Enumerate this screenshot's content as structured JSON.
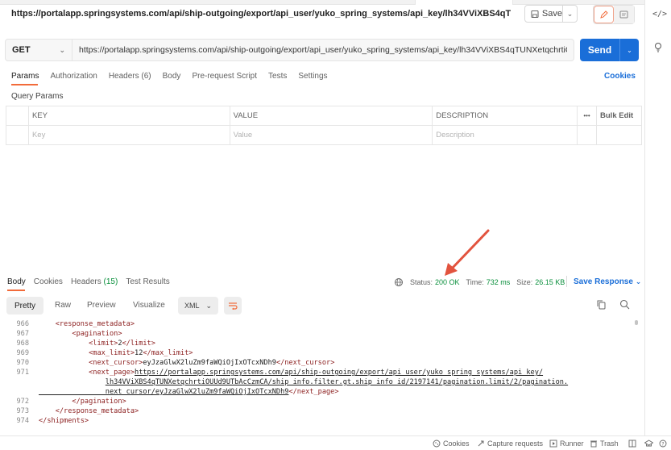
{
  "title_row": {
    "url_title": "https://portalapp.springsystems.com/api/ship-outgoing/export/api_user/yuko_spring_systems/api_key/lh34VViXBS4qTUNXetqchrtiOUUd...",
    "save_label": "Save"
  },
  "request": {
    "method": "GET",
    "url": "https://portalapp.springsystems.com/api/ship-outgoing/export/api_user/yuko_spring_systems/api_key/lh34VViXBS4qTUNXetqchrtiOUUd9UTb/...",
    "send_label": "Send"
  },
  "request_tabs": {
    "params": "Params",
    "authorization": "Authorization",
    "headers": "Headers (6)",
    "body": "Body",
    "prerequest": "Pre-request Script",
    "tests": "Tests",
    "settings": "Settings",
    "cookies": "Cookies"
  },
  "query_params": {
    "title": "Query Params",
    "columns": {
      "key": "KEY",
      "value": "VALUE",
      "description": "DESCRIPTION",
      "more": "•••",
      "bulk_edit": "Bulk Edit"
    },
    "placeholders": {
      "key": "Key",
      "value": "Value",
      "description": "Description"
    }
  },
  "response_tabs": {
    "body": "Body",
    "cookies": "Cookies",
    "headers_label": "Headers",
    "headers_count": "(15)",
    "test_results": "Test Results"
  },
  "response_status": {
    "status_label": "Status:",
    "status_value": "200 OK",
    "time_label": "Time:",
    "time_value": "732 ms",
    "size_label": "Size:",
    "size_value": "26.15 KB",
    "save_response": "Save Response"
  },
  "format_toolbar": {
    "pretty": "Pretty",
    "raw": "Raw",
    "preview": "Preview",
    "visualize": "Visualize",
    "format": "XML"
  },
  "code": {
    "line_numbers": [
      "966",
      "967",
      "968",
      "969",
      "970",
      "971",
      "",
      "",
      "972",
      "973",
      "974"
    ],
    "lines": [
      "    <response_metadata>",
      "        <pagination>",
      "            <limit>2</limit>",
      "            <max_limit>12</max_limit>",
      "            <next_cursor>eyJzaGlwX2luZm9faWQiOjIxOTcxNDh9</next_cursor>",
      "            <next_page>https://portalapp.springsystems.com/api/ship-outgoing/export/api_user/yuko_spring_systems/api_key/",
      "                lh34VViXBS4qTUNXetqchrtiOUUd9UTbAcCzmCA/ship_info.filter.gt.ship_info_id/2197141/pagination.limit/2/pagination.",
      "                next_cursor/eyJzaGlwX2luZm9faWQiOjIxOTcxNDh9</next_page>",
      "        </pagination>",
      "    </response_metadata>",
      "</shipments>"
    ]
  },
  "status_bar": {
    "cookies": "Cookies",
    "capture": "Capture requests",
    "runner": "Runner",
    "trash": "Trash"
  },
  "colors": {
    "accent_orange": "#f26b3a",
    "send_blue": "#1a6ed8",
    "status_green": "#0a8f3c",
    "xml_tag": "#8b1e1e",
    "arrow_red": "#e2533e"
  },
  "icons": [
    "save-icon",
    "edit-icon",
    "comment-icon",
    "code-icon",
    "lightbulb-icon",
    "cookie-icon",
    "wrap-icon",
    "copy-icon",
    "search-icon",
    "chevron-down-icon"
  ]
}
